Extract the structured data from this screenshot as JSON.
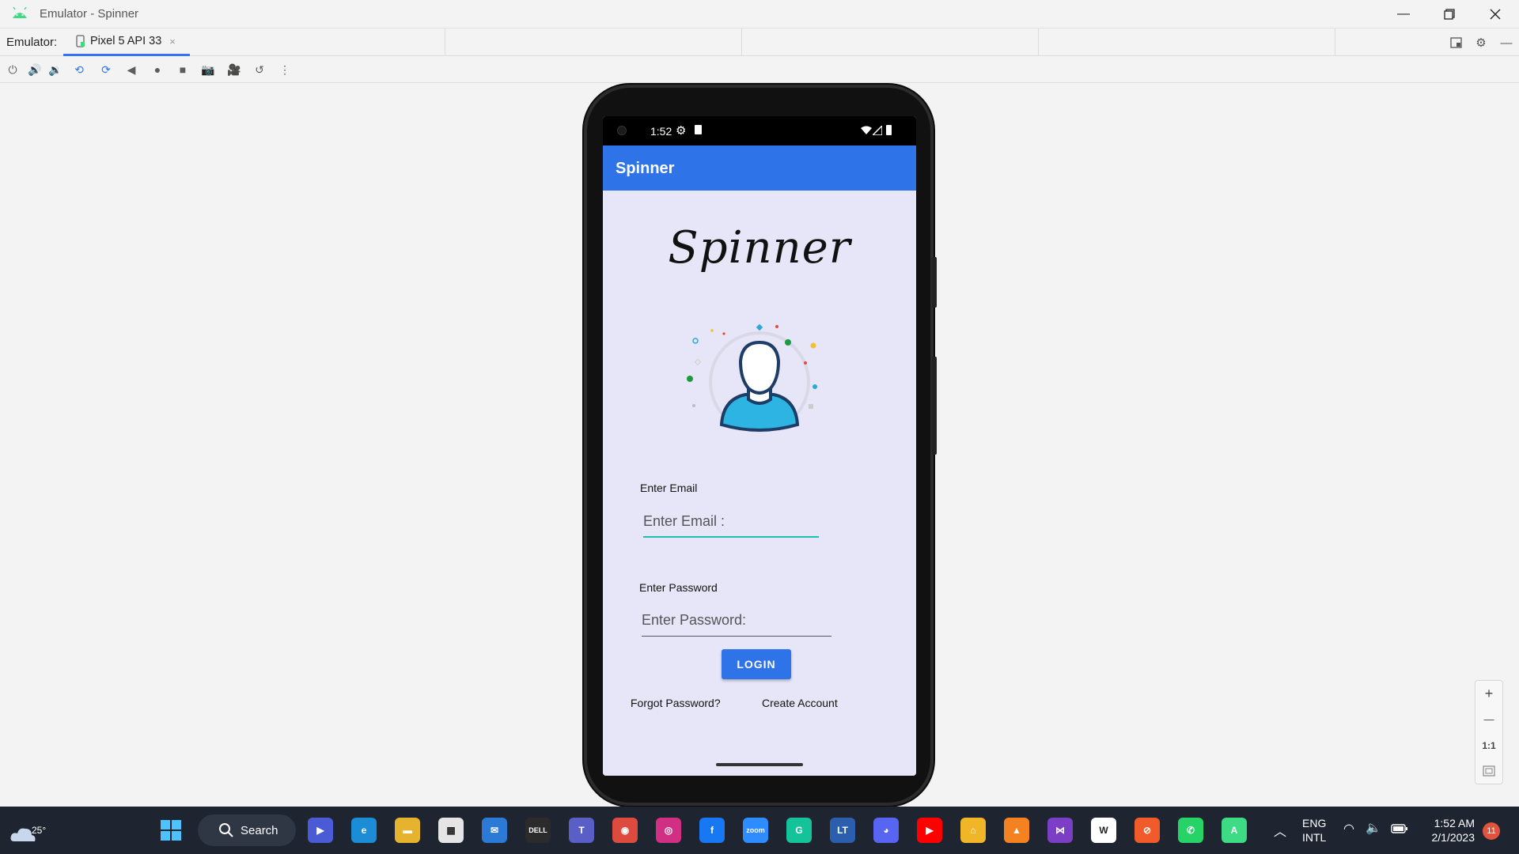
{
  "window": {
    "title": "Emulator - Spinner",
    "minimize_icon": "minimize-icon",
    "restore_icon": "restore-icon",
    "close_icon": "close-icon"
  },
  "tabbar": {
    "label": "Emulator:",
    "device_tab": "Pixel 5 API 33",
    "close_glyph": "×"
  },
  "toolbar": {
    "tools": [
      "power-icon",
      "volume-up-icon",
      "volume-down-icon",
      "rotate-left-icon",
      "rotate-right-icon",
      "back-icon",
      "home-icon",
      "overview-icon",
      "camera-icon",
      "record-icon",
      "snapshot-icon",
      "more-icon"
    ]
  },
  "phone": {
    "status_time": "1:52",
    "appbar_title": "Spinner",
    "logo_text": "Spinner",
    "email_label": "Enter Email",
    "email_placeholder": "Enter Email :",
    "password_label": "Enter Password",
    "password_placeholder": "Enter Password:",
    "login_button": "LOGIN",
    "forgot_link": "Forgot Password?",
    "create_link": "Create Account"
  },
  "zoom": {
    "zoom_in": "+",
    "zoom_out": "—",
    "actual_size": "1:1"
  },
  "taskbar": {
    "weather_temp": "25°",
    "search_label": "Search",
    "apps": [
      {
        "name": "meet-icon",
        "glyph": "▶",
        "color": "#4b5bd6"
      },
      {
        "name": "edge-icon",
        "glyph": "e",
        "color": "#1d8cd6"
      },
      {
        "name": "file-explorer-icon",
        "glyph": "▬",
        "color": "#e6b32e"
      },
      {
        "name": "store-icon",
        "glyph": "▦",
        "color": "#e5e5e5"
      },
      {
        "name": "mail-icon",
        "glyph": "✉",
        "color": "#2a7ad6"
      },
      {
        "name": "dell-icon",
        "glyph": "DELL",
        "color": "#2b2b2b"
      },
      {
        "name": "teams-icon",
        "glyph": "T",
        "color": "#5a5fc8"
      },
      {
        "name": "chrome-icon",
        "glyph": "◉",
        "color": "#dd4b3e"
      },
      {
        "name": "instagram-icon",
        "glyph": "◎",
        "color": "#d12f84"
      },
      {
        "name": "facebook-icon",
        "glyph": "f",
        "color": "#1877f2"
      },
      {
        "name": "zoom-icon",
        "glyph": "zoom",
        "color": "#2d8cff"
      },
      {
        "name": "grammarly-icon",
        "glyph": "G",
        "color": "#15c39a"
      },
      {
        "name": "languagetool-icon",
        "glyph": "LT",
        "color": "#2b5fae"
      },
      {
        "name": "discord-icon",
        "glyph": "◕",
        "color": "#5865f2"
      },
      {
        "name": "youtube-icon",
        "glyph": "▶",
        "color": "#ff0000"
      },
      {
        "name": "vpn-icon",
        "glyph": "⌂",
        "color": "#f0b627"
      },
      {
        "name": "vlc-icon",
        "glyph": "▲",
        "color": "#f58220"
      },
      {
        "name": "visual-studio-icon",
        "glyph": "⋈",
        "color": "#7a3fc4"
      },
      {
        "name": "wikipedia-icon",
        "glyph": "W",
        "color": "#ffffff"
      },
      {
        "name": "brave-icon",
        "glyph": "⊘",
        "color": "#f15a2b"
      },
      {
        "name": "whatsapp-icon",
        "glyph": "✆",
        "color": "#25d366"
      },
      {
        "name": "android-studio-icon",
        "glyph": "A",
        "color": "#3ddc84"
      }
    ],
    "lang_line1": "ENG",
    "lang_line2": "INTL",
    "clock_time": "1:52 AM",
    "clock_date": "2/1/2023",
    "notification_count": "11"
  }
}
